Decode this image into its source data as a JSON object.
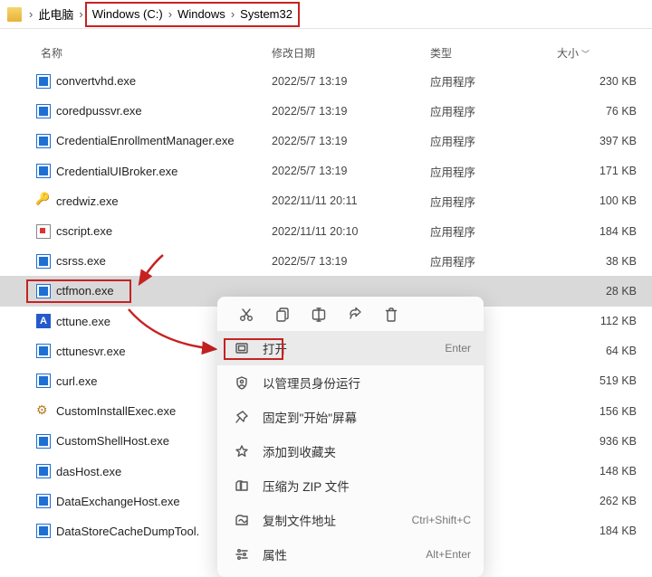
{
  "breadcrumb": {
    "root": "此电脑",
    "parts": [
      "Windows (C:)",
      "Windows",
      "System32"
    ]
  },
  "columns": {
    "name": "名称",
    "date": "修改日期",
    "type": "类型",
    "size": "大小"
  },
  "type_app": "应用程序",
  "files": [
    {
      "name": "convertvhd.exe",
      "date": "2022/5/7 13:19",
      "size": "230 KB",
      "icon": "exe"
    },
    {
      "name": "coredpussvr.exe",
      "date": "2022/5/7 13:19",
      "size": "76 KB",
      "icon": "exe"
    },
    {
      "name": "CredentialEnrollmentManager.exe",
      "date": "2022/5/7 13:19",
      "size": "397 KB",
      "icon": "exe"
    },
    {
      "name": "CredentialUIBroker.exe",
      "date": "2022/5/7 13:19",
      "size": "171 KB",
      "icon": "exe"
    },
    {
      "name": "credwiz.exe",
      "date": "2022/11/11 20:11",
      "size": "100 KB",
      "icon": "key"
    },
    {
      "name": "cscript.exe",
      "date": "2022/11/11 20:10",
      "size": "184 KB",
      "icon": "cscript"
    },
    {
      "name": "csrss.exe",
      "date": "2022/5/7 13:19",
      "size": "38 KB",
      "icon": "exe"
    },
    {
      "name": "ctfmon.exe",
      "date": "",
      "size": "28 KB",
      "icon": "exe",
      "selected": true
    },
    {
      "name": "cttune.exe",
      "date": "",
      "size": "112 KB",
      "icon": "atype"
    },
    {
      "name": "cttunesvr.exe",
      "date": "",
      "size": "64 KB",
      "icon": "exe"
    },
    {
      "name": "curl.exe",
      "date": "",
      "size": "519 KB",
      "icon": "exe"
    },
    {
      "name": "CustomInstallExec.exe",
      "date": "",
      "size": "156 KB",
      "icon": "custom"
    },
    {
      "name": "CustomShellHost.exe",
      "date": "",
      "size": "936 KB",
      "icon": "exe"
    },
    {
      "name": "dasHost.exe",
      "date": "",
      "size": "148 KB",
      "icon": "exe"
    },
    {
      "name": "DataExchangeHost.exe",
      "date": "",
      "size": "262 KB",
      "icon": "exe"
    },
    {
      "name": "DataStoreCacheDumpTool.",
      "date": "",
      "size": "184 KB",
      "icon": "exe"
    }
  ],
  "ctx_toolbar": [
    "cut",
    "copy",
    "rename",
    "share",
    "delete"
  ],
  "ctx_items": [
    {
      "icon": "open",
      "label": "打开",
      "accel": "Enter",
      "active": true
    },
    {
      "icon": "admin",
      "label": "以管理员身份运行",
      "accel": ""
    },
    {
      "icon": "pin",
      "label": "固定到\"开始\"屏幕",
      "accel": ""
    },
    {
      "icon": "star",
      "label": "添加到收藏夹",
      "accel": ""
    },
    {
      "icon": "zip",
      "label": "压缩为 ZIP 文件",
      "accel": ""
    },
    {
      "icon": "copypath",
      "label": "复制文件地址",
      "accel": "Ctrl+Shift+C"
    },
    {
      "icon": "props",
      "label": "属性",
      "accel": "Alt+Enter"
    }
  ]
}
